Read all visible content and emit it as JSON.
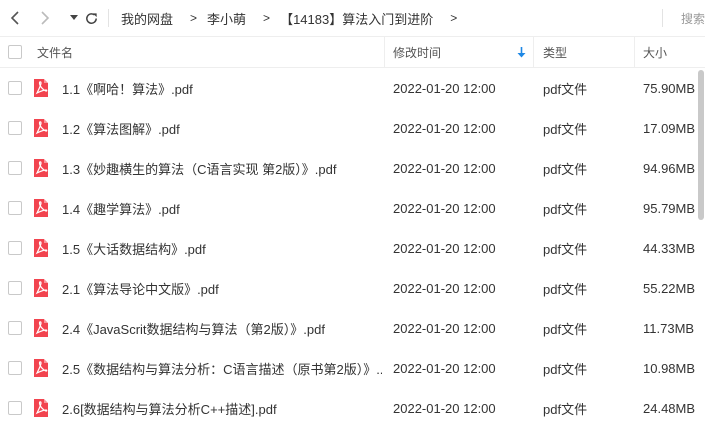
{
  "toolbar": {
    "breadcrumbs": [
      "我的网盘",
      "李小萌",
      "【14183】算法入门到进阶"
    ],
    "separator": ">",
    "search_placeholder": "搜索"
  },
  "header": {
    "name": "文件名",
    "modified": "修改时间",
    "type": "类型",
    "size": "大小",
    "sort_icon": "arrow-down-icon"
  },
  "colors": {
    "pdf": "#f2444f",
    "sort_arrow": "#1e88e5"
  },
  "files": [
    {
      "name": "1.1《啊哈！算法》.pdf",
      "modified": "2022-01-20 12:00",
      "type": "pdf文件",
      "size": "75.90MB",
      "icon": "pdf-icon"
    },
    {
      "name": "1.2《算法图解》.pdf",
      "modified": "2022-01-20 12:00",
      "type": "pdf文件",
      "size": "17.09MB",
      "icon": "pdf-icon"
    },
    {
      "name": "1.3《妙趣横生的算法（C语言实现 第2版）》.pdf",
      "modified": "2022-01-20 12:00",
      "type": "pdf文件",
      "size": "94.96MB",
      "icon": "pdf-icon"
    },
    {
      "name": "1.4《趣学算法》.pdf",
      "modified": "2022-01-20 12:00",
      "type": "pdf文件",
      "size": "95.79MB",
      "icon": "pdf-icon"
    },
    {
      "name": "1.5《大话数据结构》.pdf",
      "modified": "2022-01-20 12:00",
      "type": "pdf文件",
      "size": "44.33MB",
      "icon": "pdf-icon"
    },
    {
      "name": "2.1《算法导论中文版》.pdf",
      "modified": "2022-01-20 12:00",
      "type": "pdf文件",
      "size": "55.22MB",
      "icon": "pdf-icon"
    },
    {
      "name": "2.4《JavaScrit数据结构与算法（第2版）》.pdf",
      "modified": "2022-01-20 12:00",
      "type": "pdf文件",
      "size": "11.73MB",
      "icon": "pdf-icon"
    },
    {
      "name": "2.5《数据结构与算法分析：C语言描述（原书第2版）》....",
      "modified": "2022-01-20 12:00",
      "type": "pdf文件",
      "size": "10.98MB",
      "icon": "pdf-icon"
    },
    {
      "name": "2.6[数据结构与算法分析C++描述].pdf",
      "modified": "2022-01-20 12:00",
      "type": "pdf文件",
      "size": "24.48MB",
      "icon": "pdf-icon"
    }
  ]
}
